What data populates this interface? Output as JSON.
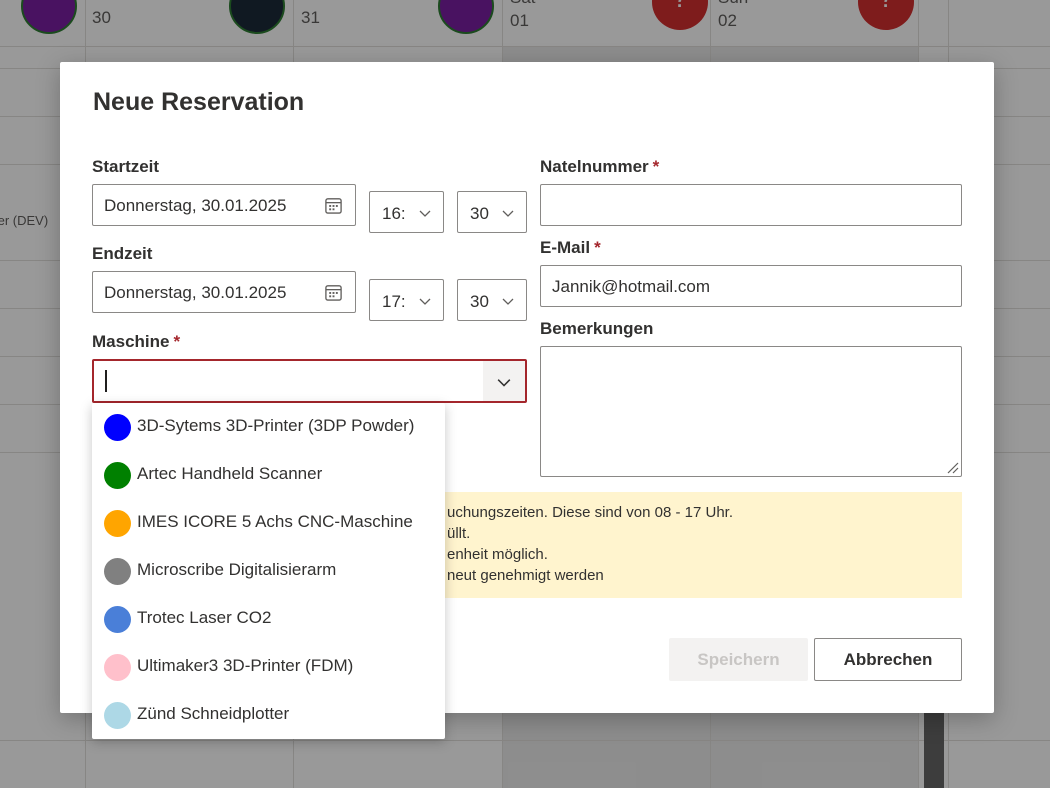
{
  "calendar": {
    "days": [
      {
        "dayname": "",
        "daynum": "30"
      },
      {
        "dayname": "",
        "daynum": "31"
      },
      {
        "dayname": "Sat",
        "daynum": "01"
      },
      {
        "dayname": "Sun",
        "daynum": "02"
      }
    ],
    "row_label": "ter (DEV)",
    "avatar_red_glyph": "?"
  },
  "dialog": {
    "title": "Neue Reservation",
    "start": {
      "label": "Startzeit",
      "date": "Donnerstag, 30.01.2025",
      "hour": "16:",
      "minute": "30"
    },
    "end": {
      "label": "Endzeit",
      "date": "Donnerstag, 30.01.2025",
      "hour": "17:",
      "minute": "30"
    },
    "machine": {
      "label": "Maschine",
      "required_mark": "*",
      "value": ""
    },
    "phone": {
      "label": "Natelnummer",
      "required_mark": "*",
      "value": ""
    },
    "email": {
      "label": "E-Mail",
      "required_mark": "*",
      "value": "Jannik@hotmail.com"
    },
    "remarks": {
      "label": "Bemerkungen",
      "value": ""
    },
    "notice_lines": [
      "uchungszeiten. Diese sind von 08 - 17 Uhr.",
      "üllt.",
      "enheit möglich.",
      "neut genehmigt werden"
    ],
    "buttons": {
      "save": "Speichern",
      "cancel": "Abbrechen"
    }
  },
  "machine_options": [
    {
      "label": "3D-Sytems 3D-Printer (3DP Powder)",
      "color": "#0000ff"
    },
    {
      "label": "Artec Handheld Scanner",
      "color": "#008000"
    },
    {
      "label": "IMES ICORE 5 Achs CNC-Maschine",
      "color": "#ffa500"
    },
    {
      "label": "Microscribe Digitalisierarm",
      "color": "#808080"
    },
    {
      "label": "Trotec Laser CO2",
      "color": "#4a7fd8"
    },
    {
      "label": "Ultimaker3 3D-Printer (FDM)",
      "color": "#ffc0cb"
    },
    {
      "label": "Zünd Schneidplotter",
      "color": "#add8e6"
    }
  ],
  "icons": {
    "date": "calendar-icon",
    "select": "chevron-down-icon",
    "resize": "resize-grip-icon"
  }
}
